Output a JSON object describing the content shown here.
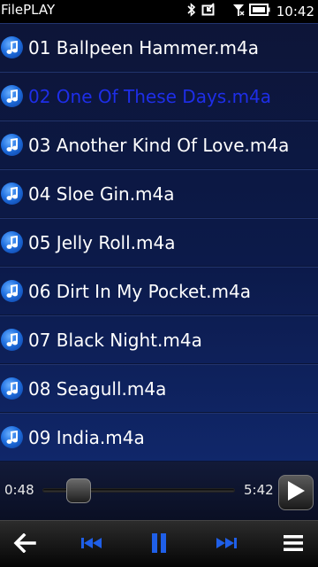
{
  "status_bar": {
    "app_name": "FilePLAY",
    "clock": "10:42",
    "icons": [
      "bluetooth-icon",
      "charging-icon",
      "no-signal-icon",
      "battery-icon"
    ]
  },
  "track_list": {
    "items": [
      {
        "label": "01 Ballpeen Hammer.m4a",
        "active": false
      },
      {
        "label": "02 One Of These Days.m4a",
        "active": true
      },
      {
        "label": "03 Another Kind Of Love.m4a",
        "active": false
      },
      {
        "label": "04 Sloe Gin.m4a",
        "active": false
      },
      {
        "label": "05 Jelly Roll.m4a",
        "active": false
      },
      {
        "label": "06 Dirt In My Pocket.m4a",
        "active": false
      },
      {
        "label": "07 Black Night.m4a",
        "active": false
      },
      {
        "label": "08 Seagull.m4a",
        "active": false
      },
      {
        "label": "09 India.m4a",
        "active": false
      }
    ],
    "item_icon": "music-note-icon"
  },
  "player": {
    "elapsed": "0:48",
    "total": "5:42",
    "progress_fraction": 0.14,
    "play_icon": "play-icon"
  },
  "toolbar": {
    "icons": [
      "back-arrow-icon",
      "previous-track-icon",
      "pause-icon",
      "next-track-icon",
      "menu-icon"
    ]
  },
  "colors": {
    "active_track": "#1e2ee8",
    "accent_blue": "#1f6fe0",
    "list_background": "#0c1a4a"
  }
}
